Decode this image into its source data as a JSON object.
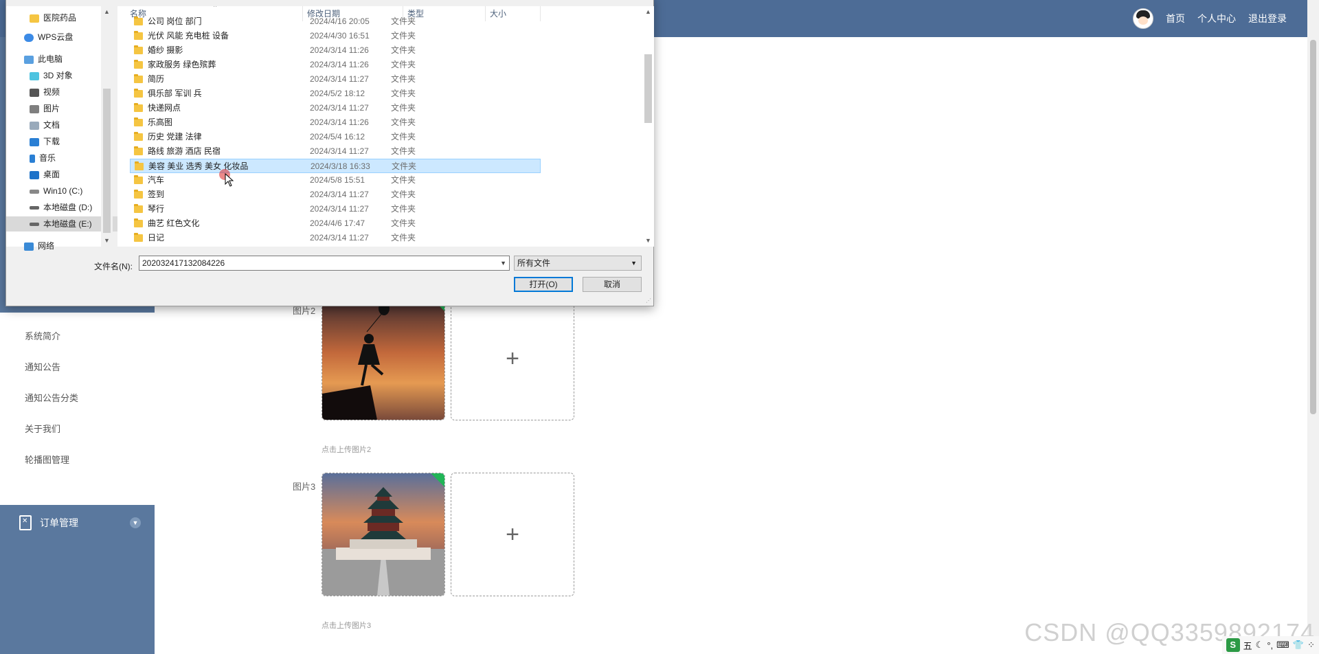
{
  "app": {
    "nav": {
      "home": "首页",
      "profile": "个人中心",
      "logout": "退出登录"
    },
    "sidebar": {
      "links": [
        "系统简介",
        "通知公告",
        "通知公告分类",
        "关于我们",
        "轮播图管理"
      ],
      "order_menu": "订单管理"
    },
    "images": [
      {
        "label": "图片2",
        "hint": "点击上传图片2"
      },
      {
        "label": "图片3",
        "hint": "点击上传图片3"
      }
    ],
    "upload_plus": "+"
  },
  "dialog": {
    "nav_items": [
      {
        "label": "医院药品",
        "icon": "folder-icon"
      },
      {
        "label": "WPS云盘",
        "icon": "cloud-icon"
      },
      {
        "label": "此电脑",
        "icon": "computer-icon"
      },
      {
        "label": "3D 对象",
        "icon": "cube-icon"
      },
      {
        "label": "视频",
        "icon": "video-icon"
      },
      {
        "label": "图片",
        "icon": "picture-icon"
      },
      {
        "label": "文档",
        "icon": "document-icon"
      },
      {
        "label": "下载",
        "icon": "download-icon"
      },
      {
        "label": "音乐",
        "icon": "music-icon"
      },
      {
        "label": "桌面",
        "icon": "desktop-icon"
      },
      {
        "label": "Win10 (C:)",
        "icon": "drive-icon"
      },
      {
        "label": "本地磁盘 (D:)",
        "icon": "drive-icon"
      },
      {
        "label": "本地磁盘 (E:)",
        "icon": "drive-icon"
      },
      {
        "label": "网络",
        "icon": "network-icon"
      }
    ],
    "columns": {
      "name": "名称",
      "date": "修改日期",
      "type": "类型",
      "size": "大小"
    },
    "files": [
      {
        "name": "公司 岗位 部门",
        "date": "2024/4/16 20:05",
        "type": "文件夹"
      },
      {
        "name": "光伏 风能 充电桩 设备",
        "date": "2024/4/30 16:51",
        "type": "文件夹"
      },
      {
        "name": "婚纱  摄影",
        "date": "2024/3/14 11:26",
        "type": "文件夹"
      },
      {
        "name": "家政服务 绿色殡葬",
        "date": "2024/3/14 11:26",
        "type": "文件夹"
      },
      {
        "name": "简历",
        "date": "2024/3/14 11:27",
        "type": "文件夹"
      },
      {
        "name": "俱乐部 军训 兵",
        "date": "2024/5/2 18:12",
        "type": "文件夹"
      },
      {
        "name": "快递网点",
        "date": "2024/3/14 11:27",
        "type": "文件夹"
      },
      {
        "name": "乐高图",
        "date": "2024/3/14 11:26",
        "type": "文件夹"
      },
      {
        "name": "历史  党建  法律",
        "date": "2024/5/4 16:12",
        "type": "文件夹"
      },
      {
        "name": "路线 旅游 酒店 民宿",
        "date": "2024/3/14 11:27",
        "type": "文件夹"
      },
      {
        "name": "美容 美业 选秀 美女 化妆品",
        "date": "2024/3/18 16:33",
        "type": "文件夹",
        "selected": true
      },
      {
        "name": "汽车",
        "date": "2024/5/8 15:51",
        "type": "文件夹"
      },
      {
        "name": "签到",
        "date": "2024/3/14 11:27",
        "type": "文件夹"
      },
      {
        "name": "琴行",
        "date": "2024/3/14 11:27",
        "type": "文件夹"
      },
      {
        "name": "曲艺  红色文化",
        "date": "2024/4/6 17:47",
        "type": "文件夹"
      },
      {
        "name": "日记",
        "date": "2024/3/14 11:27",
        "type": "文件夹"
      }
    ],
    "filename_label": "文件名(N):",
    "filename_value": "202032417132084226",
    "filetype_value": "所有文件",
    "open_button": "打开(O)",
    "cancel_button": "取消"
  },
  "watermark": "CSDN @QQ3359892174",
  "tray": {
    "s_badge": "S",
    "ime": "五"
  },
  "colors": {
    "topbar": "#4d6c96",
    "sidebar": "#5a789e",
    "selection": "#cce8ff",
    "upload_ok": "#21b557"
  }
}
